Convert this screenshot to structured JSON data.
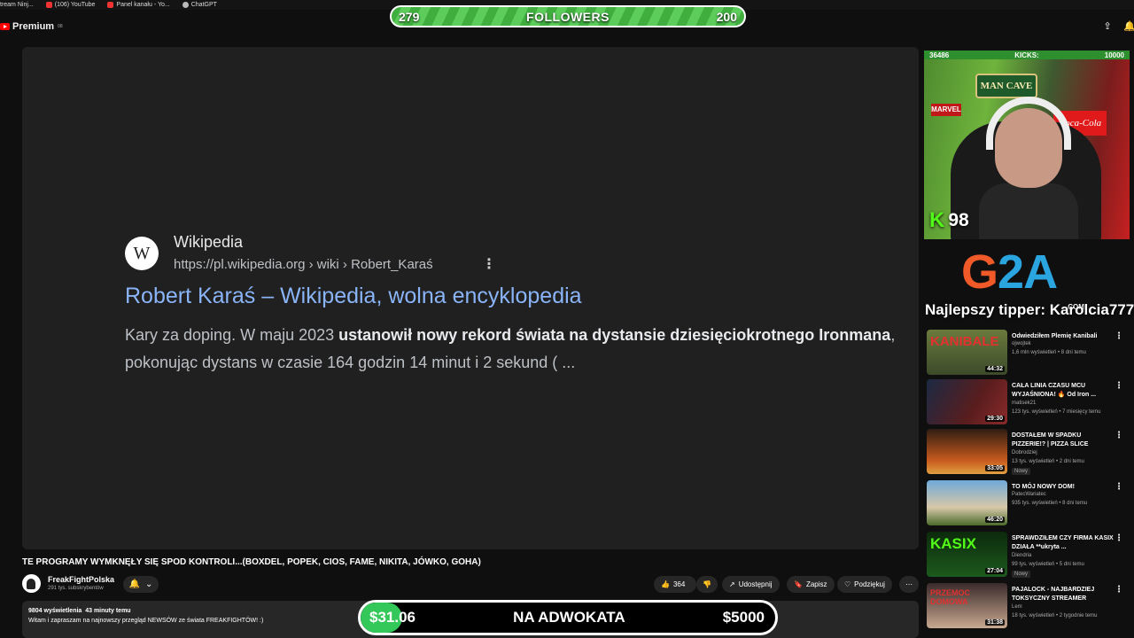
{
  "bookmarks": [
    {
      "label": "tream Ninj..."
    },
    {
      "label": "(106) YouTube"
    },
    {
      "label": "Panel kanału - Yo..."
    },
    {
      "label": "ChatGPT"
    }
  ],
  "header": {
    "logo_text": "Premium",
    "logo_sup": "08"
  },
  "followers": {
    "left": "279",
    "center": "FOLLOWERS",
    "right": "200"
  },
  "wiki": {
    "logo_letter": "W",
    "site": "Wikipedia",
    "url": "https://pl.wikipedia.org › wiki › Robert_Karaś",
    "dots": "⋮",
    "title": "Robert Karaś – Wikipedia, wolna encyklopedia",
    "snippet_a": "Kary za doping. W maju 2023 ",
    "snippet_bold1": "ustanowił nowy rekord świata na dystansie dziesięciokrotnego Ironmana",
    "snippet_b": ", pokonując dystans w czasie 164 godzin 14 minut i 2 sekund ( ..."
  },
  "video": {
    "title": "TE PROGRAMY WYMKNĘŁY SIĘ SPOD KONTROLI...(BOXDEL, POPEK, CIOS, FAME, NIKITA, JÓWKO, GOHA)",
    "channel": "FreakFightPolska",
    "subs": "291 tys. subskrybentów",
    "likes": "364",
    "share": "Udostępnij",
    "save": "Zapisz",
    "thanks": "Podziękuj",
    "more": "⋯",
    "views": "9804 wyświetlenia",
    "time": "43 minuty temu",
    "desc": "Witam i zapraszam na najnowszy przegląd NEWSÓW ze świata FREAKFIGHTÓW! :)"
  },
  "donation": {
    "current": "$31.06",
    "label": "NA ADWOKATA",
    "goal": "$5000",
    "progress": 0.0062
  },
  "cam": {
    "top_left": "36486",
    "top_mid": "KICKS:",
    "top_right": "10000",
    "kicks": "98",
    "sign": "MAN CAVE",
    "marvel": "MARVEL",
    "coke": "Coca-Cola"
  },
  "g2a": {
    "logo": "G2A",
    "com": ".COM",
    "tipper": "Najlepszy tipper: Karolcia777"
  },
  "recs": [
    {
      "title": "Odwiedziłem Plemię Kanibali",
      "channel": "ojwojtek",
      "stats": "1,6 mln wyświetleń • 8 dni temu",
      "duration": "44:32",
      "thumb": "KANIBALE",
      "new": ""
    },
    {
      "title": "CAŁA LINIA CZASU MCU WYJAŚNIONA! 🔥 Od Iron ...",
      "channel": "matisek21",
      "stats": "123 tys. wyświetleń • 7 miesięcy temu",
      "duration": "29:30",
      "thumb": "",
      "new": ""
    },
    {
      "title": "DOSTAŁEM W SPADKU PIZZERIE!? | PIZZA SLICE",
      "channel": "Dobrodziej",
      "stats": "13 tys. wyświetleń • 2 dni temu",
      "duration": "33:05",
      "thumb": "",
      "new": "Nowy"
    },
    {
      "title": "TO MÓJ NOWY DOM!",
      "channel": "PatecWariatec",
      "stats": "935 tys. wyświetleń • 8 dni temu",
      "duration": "46:20",
      "thumb": "",
      "new": ""
    },
    {
      "title": "SPRAWDZIŁEM CZY FIRMA KASIX DZIAŁA **ukryta ...",
      "channel": "Diendria",
      "stats": "99 tys. wyświetleń • 5 dni temu",
      "duration": "27:04",
      "thumb": "KASIX",
      "new": "Nowy"
    },
    {
      "title": "PAJALOCK - NAJBARDZIEJ TOKSYCZNY STREAMER",
      "channel": "Lem",
      "stats": "18 tys. wyświetleń • 2 tygodnie temu",
      "duration": "31:38",
      "thumb": "PRZEMOC DOMOWA",
      "new": ""
    }
  ]
}
